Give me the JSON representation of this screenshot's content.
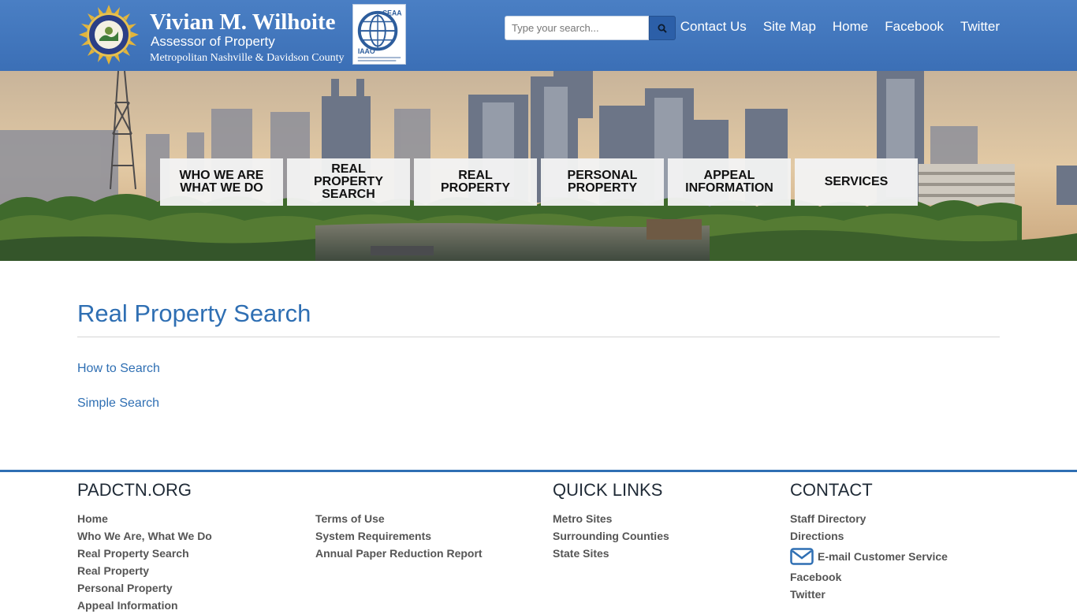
{
  "header": {
    "name": "Vivian M. Wilhoite",
    "subtitle": "Assessor of Property",
    "county": "Metropolitan Nashville & Davidson County",
    "badge_top": "CEAA",
    "badge_bottom": "IAAO"
  },
  "search": {
    "placeholder": "Type your search..."
  },
  "top_nav": [
    "Contact Us",
    "Site Map",
    "Home",
    "Facebook",
    "Twitter"
  ],
  "main_nav": [
    {
      "line1": "WHO WE ARE",
      "line2": "WHAT WE DO"
    },
    {
      "line1": "REAL",
      "line2": "PROPERTY",
      "line3": "SEARCH"
    },
    {
      "line1": "REAL",
      "line2": "PROPERTY"
    },
    {
      "line1": "PERSONAL",
      "line2": "PROPERTY"
    },
    {
      "line1": "APPEAL",
      "line2": "INFORMATION"
    },
    {
      "line1": "SERVICES"
    }
  ],
  "content": {
    "title": "Real Property Search",
    "links": [
      "How to Search",
      "Simple Search"
    ]
  },
  "footer": {
    "col1_heading": "PADCTN.ORG",
    "col1_links": [
      "Home",
      "Who We Are, What We Do",
      "Real Property Search",
      "Real Property",
      "Personal Property",
      "Appeal Information"
    ],
    "col2_links": [
      "Terms of Use",
      "System Requirements",
      "Annual Paper Reduction Report"
    ],
    "col3_heading": "QUICK LINKS",
    "col3_links": [
      "Metro Sites",
      "Surrounding Counties",
      "State Sites"
    ],
    "col4_heading": "CONTACT",
    "col4_links": [
      "Staff Directory",
      "Directions",
      "E-mail Customer Service",
      "Facebook",
      "Twitter"
    ]
  },
  "colors": {
    "header_blue": "#3b6fb6",
    "link_blue": "#2f6fb3",
    "footer_text": "#555555"
  },
  "icons": {
    "seal": "metro-seal-icon",
    "search": "search-icon",
    "email": "envelope-icon"
  }
}
